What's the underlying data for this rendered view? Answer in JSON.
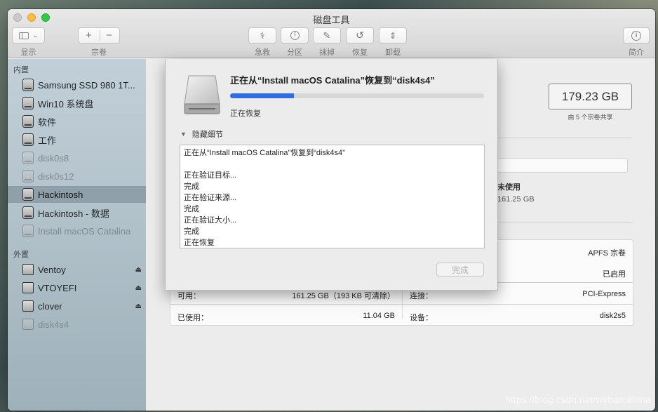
{
  "window": {
    "title": "磁盘工具"
  },
  "toolbar": {
    "view_label": "显示",
    "volume_label": "宗卷",
    "volume_add": "+",
    "volume_remove": "−",
    "firstaid_label": "急救",
    "partition_label": "分区",
    "erase_label": "抹掉",
    "restore_label": "恢复",
    "unmount_label": "卸载",
    "info_label": "简介"
  },
  "sidebar": {
    "internal_header": "内置",
    "external_header": "外置",
    "internal": [
      {
        "label": "Samsung SSD 980 1T...",
        "dim": false,
        "selected": false
      },
      {
        "label": "Win10 系统盘",
        "dim": false,
        "selected": false
      },
      {
        "label": "软件",
        "dim": false,
        "selected": false
      },
      {
        "label": "工作",
        "dim": false,
        "selected": false
      },
      {
        "label": "disk0s8",
        "dim": true,
        "selected": false
      },
      {
        "label": "disk0s12",
        "dim": true,
        "selected": false
      },
      {
        "label": "Hackintosh",
        "dim": false,
        "selected": true
      },
      {
        "label": "Hackintosh - 数据",
        "dim": false,
        "selected": false
      },
      {
        "label": "Install macOS Catalina",
        "dim": true,
        "selected": false
      }
    ],
    "external": [
      {
        "label": "Ventoy",
        "dim": false,
        "eject": "⏏"
      },
      {
        "label": "VTOYEFI",
        "dim": false,
        "eject": "⏏"
      },
      {
        "label": "clover",
        "dim": false,
        "eject": "⏏"
      },
      {
        "label": "disk4s4",
        "dim": true,
        "eject": ""
      }
    ]
  },
  "main": {
    "capacity": "179.23 GB",
    "capacity_note": "由 5 个宗卷共享",
    "used_heading": "未使用",
    "used_value": "161.25 GB",
    "info": {
      "type_value": "APFS 宗卷",
      "owners_value": "已启用",
      "available_label": "可用：",
      "available_value": "161.25 GB（193 KB 可清除）",
      "connection_label": "连接：",
      "connection_value": "PCI-Express",
      "used_label": "已使用：",
      "used_value": "11.04 GB",
      "device_label": "设备：",
      "device_value": "disk2s5"
    }
  },
  "sheet": {
    "title": "正在从“Install macOS Catalina”恢复到“disk4s4”",
    "progress": 0.25,
    "status": "正在恢复",
    "details_toggle": "隐藏细节",
    "log": "正在从“Install macOS Catalina”恢复到“disk4s4”\n\n正在验证目标...\n完成\n正在验证来源...\n完成\n正在验证大小...\n完成\n正在恢复",
    "done_button": "完成"
  },
  "watermark": "https://blog.csdn.net/wybarcelona"
}
